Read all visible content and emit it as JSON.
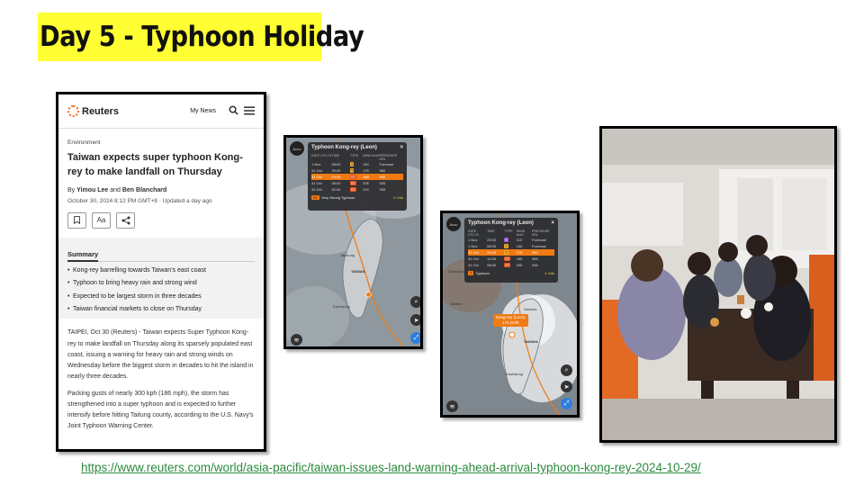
{
  "slide": {
    "title": "Day 5 - Typhoon Holiday",
    "source_url": "https://www.reuters.com/world/asia-pacific/taiwan-issues-land-warning-ahead-arrival-typhoon-kong-rey-2024-10-29/"
  },
  "colors": {
    "title_highlight": "#ffff33",
    "reuters_orange": "#f26b21",
    "storm_orange": "#f07a14",
    "link_green": "#2a8a3e"
  },
  "article": {
    "logo": "Reuters",
    "my_news": "My News",
    "section": "Environment",
    "headline": "Taiwan expects super typhoon Kong-rey to make landfall on Thursday",
    "byline_prefix": "By",
    "author1": "Yimou Lee",
    "byline_and": "and",
    "author2": "Ben Blanchard",
    "date": "October 30, 2024 8:12 PM GMT+8 · Updated a day ago",
    "font_button": "Aa",
    "summary_tab": "Summary",
    "bullets": [
      "Kong-rey barrelling towards Taiwan's east coast",
      "Typhoon to bring heavy rain and strong wind",
      "Expected to be largest storm in three decades",
      "Taiwan financial markets to close on Thursday"
    ],
    "paragraph1": "TAIPEI, Oct 30 (Reuters) - Taiwan expects Super Typhoon Kong-rey to make landfall on Thursday along its sparsely populated east coast, issuing a warning for heavy rain and strong winds on Wednesday before the biggest storm in decades to hit the island in nearly three decades.",
    "paragraph2": "Packing gusts of nearly 300 kph (186 mph), the storm has strengthened into a super typhoon and is expected to further intensify before hitting Taitung county, according to the U.S. Navy's Joint Typhoon Warning Center."
  },
  "map1": {
    "title": "Typhoon Kong-rey (Leon)",
    "close": "×",
    "headers": [
      "DATE UTC+8",
      "TIME",
      "TYPE",
      "WIND km/h",
      "PRESSURE hPa"
    ],
    "rows": [
      [
        "1 Nov",
        "08:00",
        "T",
        "140",
        "Forecast"
      ],
      [
        "31 Oct",
        "20:00",
        "T",
        "175",
        "980"
      ],
      [
        "31 Oct",
        "14:00",
        "ST",
        "185",
        "955"
      ],
      [
        "31 Oct",
        "08:00",
        "ST",
        "205",
        "935"
      ],
      [
        "31 Oct",
        "02:00",
        "ST",
        "215",
        "939"
      ]
    ],
    "highlight_row": 2,
    "legend_tag": "ST",
    "legend_text": "Very Strong Typhoon",
    "info": "Info",
    "logo": "Accu",
    "labels": [
      "Taichung",
      "TAIWAN",
      "Kaohsiung"
    ]
  },
  "map2": {
    "title": "Typhoon Kong-rey (Leon)",
    "close": "×",
    "headers": [
      "DATE UTC+8",
      "TIME",
      "TYPE",
      "WIND km/h",
      "PRESSURE hPa"
    ],
    "rows": [
      [
        "1 Nov",
        "20:00",
        "S",
        "110",
        "Forecast"
      ],
      [
        "1 Nov",
        "08:00",
        "T",
        "140",
        "Forecast"
      ],
      [
        "31 Oct",
        "20:00",
        "T",
        "175",
        "980"
      ],
      [
        "31 Oct",
        "14:00",
        "ST",
        "185",
        "955"
      ],
      [
        "31 Oct",
        "08:00",
        "ST",
        "205",
        "935"
      ]
    ],
    "highlight_row": 2,
    "legend_tag": "T",
    "legend_text": "Typhoon",
    "info": "Info",
    "logo": "Accu",
    "storm_name": "Kong-rey (Leon)",
    "storm_wind": "175 km/h",
    "labels": [
      "Hsinchu",
      "TAIWAN",
      "Kaohsiung",
      "Quanzhou",
      "Xiamen"
    ]
  }
}
